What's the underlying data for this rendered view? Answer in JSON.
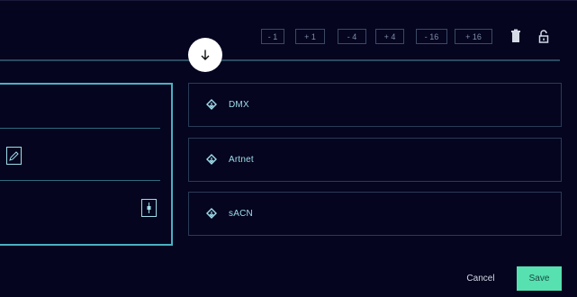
{
  "toolbar": {
    "steps": [
      "- 1",
      "+ 1",
      "- 4",
      "+ 4",
      "- 16",
      "+ 16"
    ],
    "icons": [
      "trash-icon",
      "unlock-icon"
    ]
  },
  "center_button": {
    "icon": "arrow-down-icon"
  },
  "protocols": [
    {
      "label": "DMX",
      "icon": "network-icon"
    },
    {
      "label": "Artnet",
      "icon": "network-icon"
    },
    {
      "label": "sACN",
      "icon": "network-icon"
    }
  ],
  "footer": {
    "cancel_label": "Cancel",
    "save_label": "Save"
  },
  "colors": {
    "accent": "#57e0b0",
    "border": "#4bb0c0",
    "background": "#050520"
  }
}
